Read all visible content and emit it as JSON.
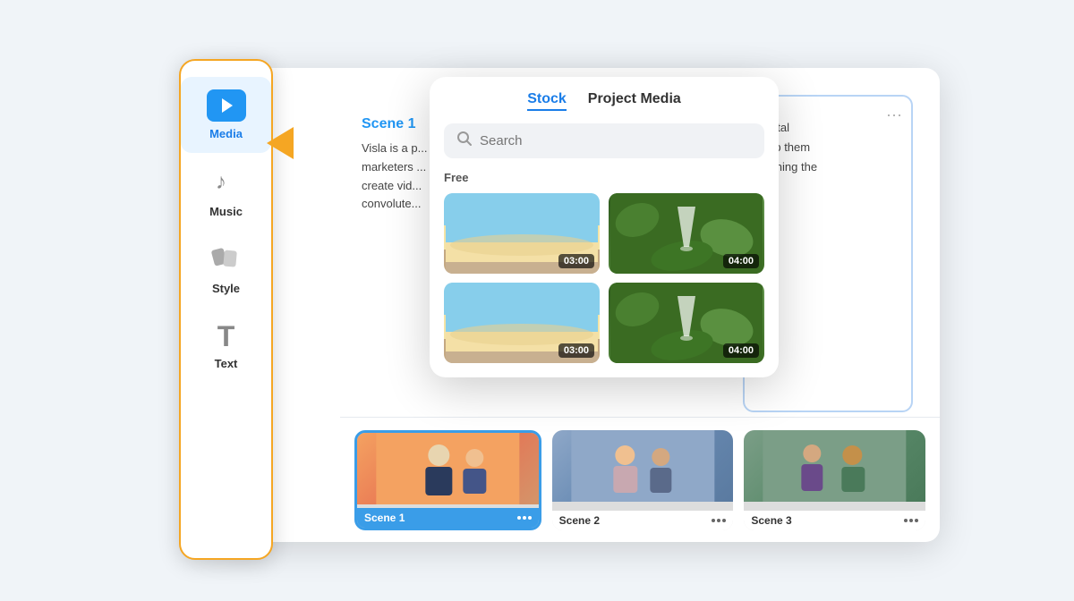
{
  "sidebar": {
    "items": [
      {
        "id": "media",
        "label": "Media",
        "active": true
      },
      {
        "id": "music",
        "label": "Music",
        "active": false
      },
      {
        "id": "style",
        "label": "Style",
        "active": false
      },
      {
        "id": "text",
        "label": "Text",
        "active": false
      }
    ]
  },
  "picker": {
    "tabs": [
      {
        "id": "stock",
        "label": "Stock",
        "active": true
      },
      {
        "id": "project",
        "label": "Project Media",
        "active": false
      }
    ],
    "search": {
      "placeholder": "Search"
    },
    "free_label": "Free",
    "media_items": [
      {
        "id": "beach1",
        "duration": "03:00",
        "type": "beach"
      },
      {
        "id": "drink1",
        "duration": "04:00",
        "type": "drink"
      },
      {
        "id": "beach2",
        "duration": "03:00",
        "type": "beach"
      },
      {
        "id": "drink2",
        "duration": "04:00",
        "type": "drink"
      }
    ]
  },
  "editor": {
    "scene1": {
      "title": "Scene 1",
      "text": "Visla is a p... marketers ... create vid... convolute..."
    },
    "right_panel": {
      "text": "digital\nhelp them\nearning the"
    },
    "scenes": [
      {
        "label": "Scene 1",
        "id": "scene-1"
      },
      {
        "label": "Scene 2",
        "id": "scene-2"
      },
      {
        "label": "Scene 3",
        "id": "scene-3"
      }
    ]
  },
  "icons": {
    "search": "🔍",
    "music_note": "♪",
    "style": "🎨",
    "text_t": "T",
    "dots": "···"
  }
}
